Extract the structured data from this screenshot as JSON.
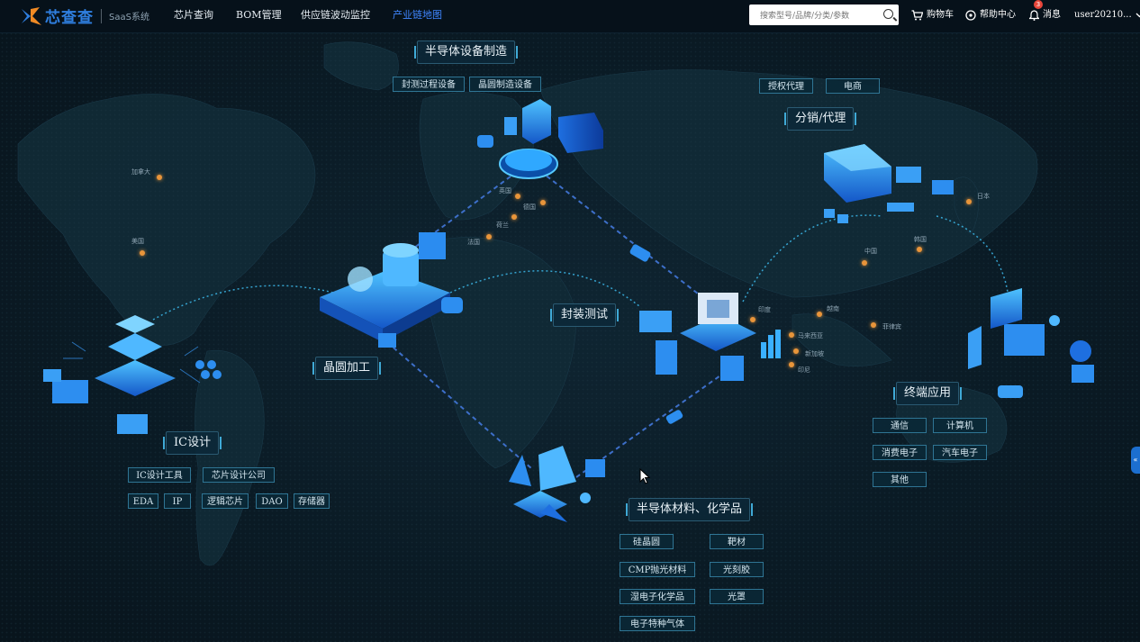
{
  "header": {
    "brand_name": "芯查查",
    "brand_sub": "SaaS系统",
    "nav": [
      "芯片查询",
      "BOM管理",
      "供应链波动监控",
      "产业链地图"
    ],
    "active_nav": "产业链地图",
    "search_placeholder": "搜索型号/品牌/分类/参数",
    "cart_label": "购物车",
    "help_label": "帮助中心",
    "message_label": "消息",
    "message_count": "3",
    "user_label": "user20210..."
  },
  "sections": {
    "equipment": {
      "title": "半导体设备制造",
      "tags": [
        "封测过程设备",
        "晶圆制造设备"
      ]
    },
    "distribution": {
      "title": "分销/代理",
      "tags": [
        "授权代理",
        "电商"
      ]
    },
    "wafer": {
      "title": "晶圆加工"
    },
    "packaging": {
      "title": "封装测试"
    },
    "ic_design": {
      "title": "IC设计",
      "tags_row1": [
        "IC设计工具",
        "芯片设计公司"
      ],
      "tags_row2": [
        "EDA",
        "IP",
        "逻辑芯片",
        "DAO",
        "存储器"
      ]
    },
    "materials": {
      "title": "半导体材料、化学品",
      "tags": [
        "硅晶圆",
        "靶材",
        "CMP抛光材料",
        "光刻胶",
        "湿电子化学品",
        "光罩",
        "电子特种气体"
      ]
    },
    "terminal": {
      "title": "终端应用",
      "tags": [
        "通信",
        "计算机",
        "消费电子",
        "汽车电子",
        "其他"
      ]
    }
  },
  "countries": [
    "加拿大",
    "美国",
    "英国",
    "德国",
    "荷兰",
    "法国",
    "中国",
    "韩国",
    "日本",
    "印度",
    "越南",
    "菲律宾",
    "马来西亚",
    "新加坡",
    "印尼"
  ],
  "side_tab_icon": "«",
  "colors": {
    "accent": "#3f86ff",
    "node_glow": "#2aa6ff",
    "marker": "#e9953a",
    "route": "#3d6fc9"
  },
  "icons": [
    "logo-icon",
    "search-icon",
    "cart-icon",
    "help-icon",
    "bell-icon",
    "chevron-down-icon",
    "cursor-icon"
  ]
}
